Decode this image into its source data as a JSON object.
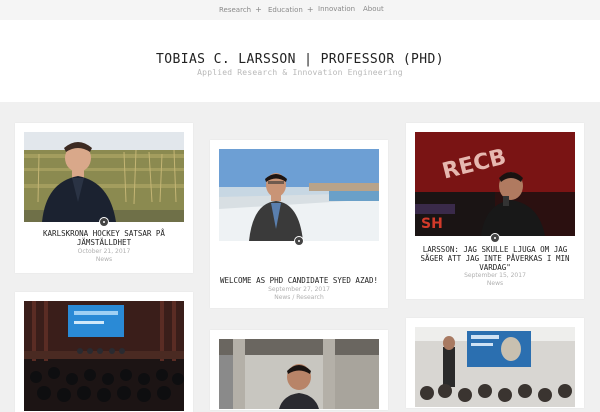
{
  "nav": {
    "items": [
      {
        "label": "Research",
        "has_submenu": true
      },
      {
        "label": "Education",
        "has_submenu": true
      },
      {
        "label": "Innovation",
        "has_submenu": false
      },
      {
        "label": "About",
        "has_submenu": false
      }
    ],
    "submenu_glyph": "+"
  },
  "site": {
    "title": "TOBIAS C. LARSSON | PROFESSOR (PHD)",
    "subtitle": "Applied Research & Innovation Engineering"
  },
  "posts": [
    {
      "title": "KARLSKRONA HOCKEY SATSAR PÅ JÄMSTÄLLDHET",
      "date": "October 21, 2017",
      "category": "News",
      "icon": "post-format-badge-icon"
    },
    {
      "title": "WELCOME AS PHD CANDIDATE SYED AZAD!",
      "date": "September 27, 2017",
      "category": "News / Research",
      "icon": "post-format-badge-icon"
    },
    {
      "title": "LARSSON: JAG SKULLE LJUGA OM JAG SÄGER ATT JAG INTE PÅVERKAS I MIN VARDAG\"",
      "date": "September 15, 2017",
      "category": "News",
      "icon": "post-format-badge-icon"
    },
    {
      "title": "",
      "date": "",
      "category": "",
      "icon": "post-format-badge-icon"
    },
    {
      "title": "",
      "date": "",
      "category": "",
      "icon": "post-format-badge-icon"
    },
    {
      "title": "",
      "date": "",
      "category": "",
      "icon": "post-format-badge-icon"
    }
  ],
  "colors": {
    "page_bg": "#f0f0f0",
    "card_bg": "#ffffff",
    "title_text": "#222222",
    "meta_text": "#b0b0b0",
    "nav_text": "#8a8a8a"
  }
}
